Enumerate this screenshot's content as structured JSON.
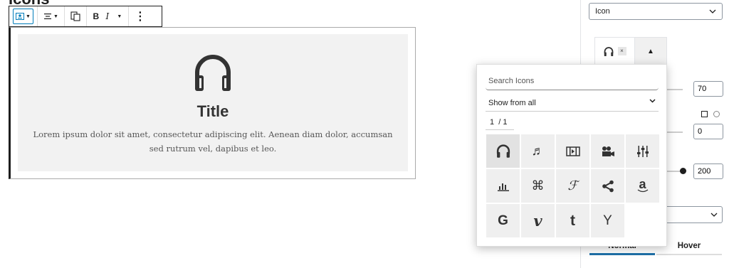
{
  "page": {
    "heading_cut": "Icons"
  },
  "toolbar": {
    "bold": "B",
    "italic": "I",
    "more": "⋮"
  },
  "card": {
    "icon": "headphones-icon",
    "title": "Title",
    "text": "Lorem ipsum dolor sit amet, consectetur adipiscing elit. Aenean diam dolor, accumsan sed rutrum vel, dapibus et leo."
  },
  "sidebar": {
    "type_select": "Icon",
    "remove_icon": "×",
    "toggle_arrow": "▲",
    "size_value": "70",
    "border_value": "0",
    "width_value": "200",
    "tabs": [
      "Normal",
      "Hover"
    ]
  },
  "picker": {
    "search_placeholder": "Search Icons",
    "show_from": "Show from all",
    "page": "1",
    "page_total": "/ 1",
    "icons": [
      {
        "name": "headphones-icon",
        "glyph": ""
      },
      {
        "name": "music-note-icon",
        "glyph": "♬"
      },
      {
        "name": "film-icon",
        "glyph": ""
      },
      {
        "name": "video-camera-icon",
        "glyph": ""
      },
      {
        "name": "equalizer-icon",
        "glyph": ""
      },
      {
        "name": "bar-chart-icon",
        "glyph": ""
      },
      {
        "name": "command-icon",
        "glyph": "⌘"
      },
      {
        "name": "foursquare-f-icon",
        "glyph": "ℱ"
      },
      {
        "name": "share-icon",
        "glyph": ""
      },
      {
        "name": "amazon-icon",
        "glyph": "a"
      },
      {
        "name": "google-icon",
        "glyph": "G"
      },
      {
        "name": "vimeo-icon",
        "glyph": "v"
      },
      {
        "name": "tumblr-icon",
        "glyph": "t"
      },
      {
        "name": "ycombinator-icon",
        "glyph": "Y"
      }
    ]
  }
}
